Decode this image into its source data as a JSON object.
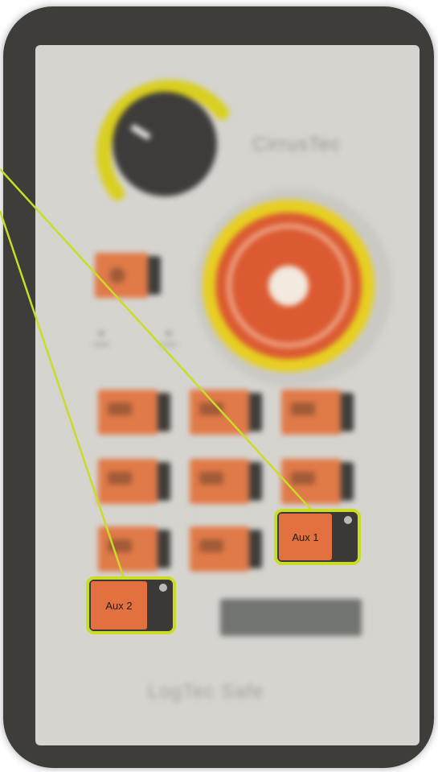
{
  "device": {
    "brand_text": "CirrusTec",
    "footer_text": "LogTec Safe"
  },
  "buttons": {
    "aux1": {
      "label": "Aux 1"
    },
    "aux2": {
      "label": "Aux 2"
    }
  },
  "colors": {
    "highlight": "#c9dc26",
    "button_orange": "#e2713f",
    "estop_red": "#db5a31",
    "estop_ring": "#e7cf22"
  },
  "icons": [
    "power-icon",
    "emergency-stop",
    "rotary-knob"
  ]
}
